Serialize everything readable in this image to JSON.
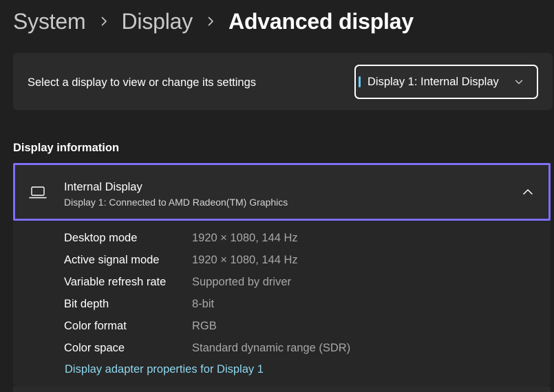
{
  "breadcrumb": {
    "items": [
      "System",
      "Display"
    ],
    "current": "Advanced display"
  },
  "select_display": {
    "label": "Select a display to view or change its settings",
    "dropdown_value": "Display 1: Internal Display"
  },
  "section": {
    "title": "Display information"
  },
  "display_card": {
    "title": "Internal Display",
    "subtitle": "Display 1: Connected to AMD Radeon(TM) Graphics",
    "rows": [
      {
        "label": "Desktop mode",
        "value": "1920 × 1080, 144 Hz"
      },
      {
        "label": "Active signal mode",
        "value": "1920 × 1080, 144 Hz"
      },
      {
        "label": "Variable refresh rate",
        "value": "Supported by driver"
      },
      {
        "label": "Bit depth",
        "value": "8-bit"
      },
      {
        "label": "Color format",
        "value": "RGB"
      },
      {
        "label": "Color space",
        "value": "Standard dynamic range (SDR)"
      }
    ],
    "link": "Display adapter properties for Display 1"
  },
  "colors": {
    "background": "#202020",
    "card": "#2b2b2b",
    "accent": "#60cdff",
    "focus_border": "#7c6ff7",
    "link": "#8fd7ee"
  },
  "icons": {
    "breadcrumb_separator": "chevron-right-icon",
    "dropdown": "chevron-down-icon",
    "expander": "chevron-up-icon",
    "display": "laptop-icon"
  }
}
